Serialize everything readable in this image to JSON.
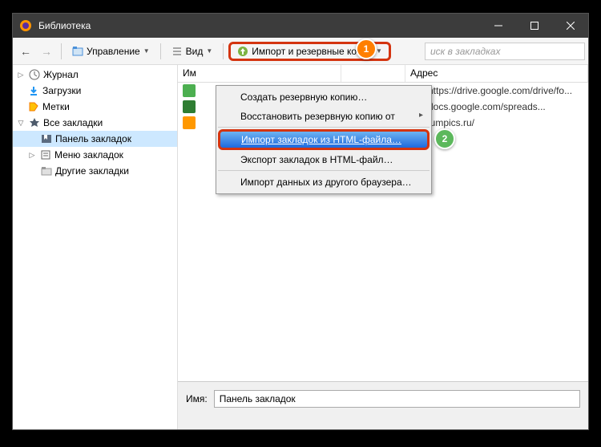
{
  "window": {
    "title": "Библиотека"
  },
  "toolbar": {
    "manage": "Управление",
    "view": "Вид",
    "import": "Импорт и резервные копии"
  },
  "search": {
    "placeholder": "иск в закладках"
  },
  "sidebar": {
    "history": "Журнал",
    "downloads": "Загрузки",
    "tags": "Метки",
    "all_bookmarks": "Все закладки",
    "toolbar_folder": "Панель закладок",
    "menu_folder": "Меню закладок",
    "other_folder": "Другие закладки"
  },
  "columns": {
    "name": "Им",
    "tags": "",
    "address": "Адрес"
  },
  "rows": [
    {
      "icon_bg": "#4caf50",
      "icon_txt": "",
      "addr": "https://drive.google.com/drive/fo..."
    },
    {
      "icon_bg": "#2e7d32",
      "icon_txt": "",
      "addr": "docs.google.com/spreads..."
    },
    {
      "icon_bg": "#ff9800",
      "icon_txt": "",
      "addr": "lumpics.ru/"
    }
  ],
  "menu": {
    "backup": "Создать резервную копию…",
    "restore": "Восстановить резервную копию от",
    "import_html": "Импорт закладок из HTML-файла…",
    "export_html": "Экспорт закладок в HTML-файл…",
    "import_browser": "Импорт данных из другого браузера…"
  },
  "details": {
    "name_label": "Имя:",
    "name_value": "Панель закладок"
  },
  "badges": {
    "b1": "1",
    "b2": "2"
  }
}
